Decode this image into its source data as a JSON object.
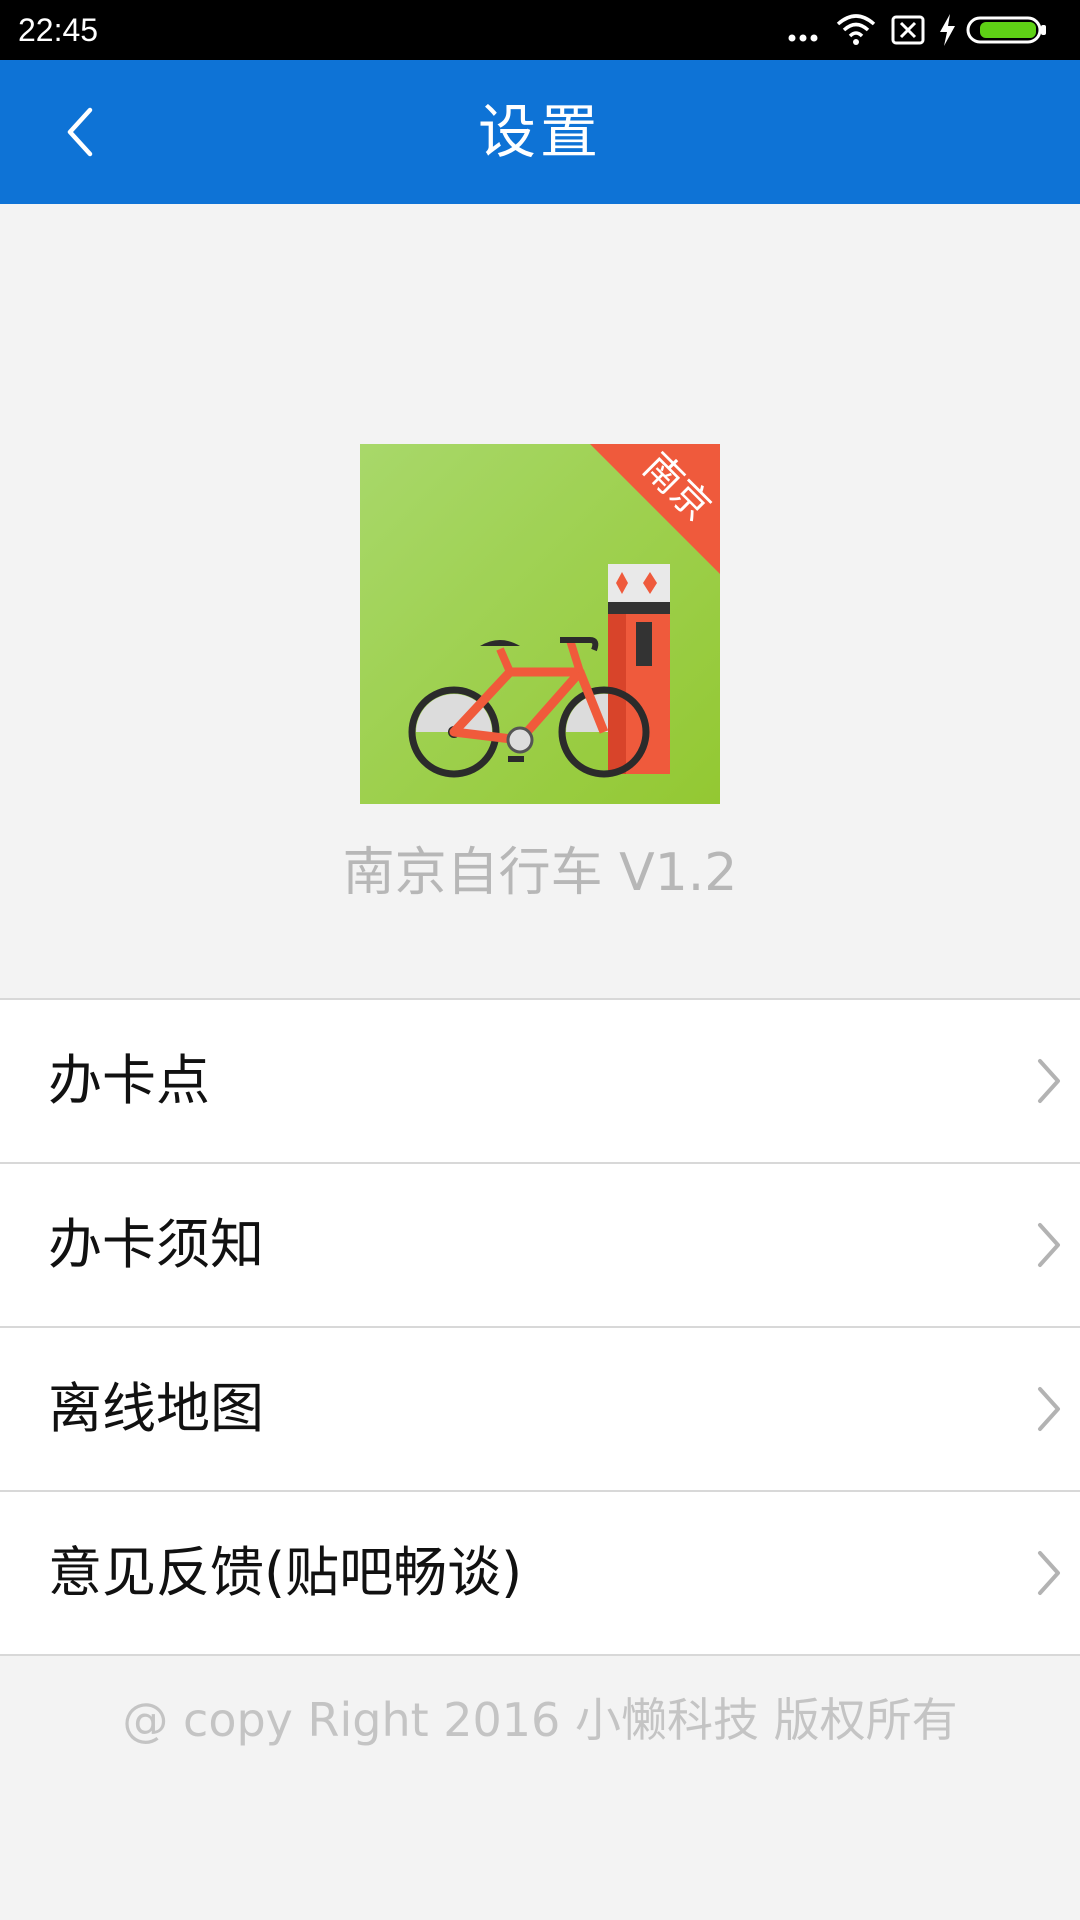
{
  "status_bar": {
    "time": "22:45",
    "icons": [
      "more-dots-icon",
      "wifi-icon",
      "no-sim-icon",
      "charging-icon",
      "battery-icon"
    ]
  },
  "header": {
    "back_icon": "chevron-left-icon",
    "title": "设置"
  },
  "logo": {
    "badge_text": "南京",
    "colors": {
      "background": "#9cd04b",
      "badge": "#ef5a3c",
      "bike": "#f05a3b"
    }
  },
  "app_version": "南京自行车 V1.2",
  "menu": {
    "items": [
      {
        "label": "办卡点"
      },
      {
        "label": "办卡须知"
      },
      {
        "label": "离线地图"
      },
      {
        "label": "意见反馈(贴吧畅谈)"
      }
    ]
  },
  "footer": {
    "copyright": "@ copy Right 2016 小懒科技 版权所有"
  },
  "colors": {
    "app_bar": "#0e73d6",
    "page_background": "#f3f3f3",
    "divider": "#d8d8d8"
  }
}
